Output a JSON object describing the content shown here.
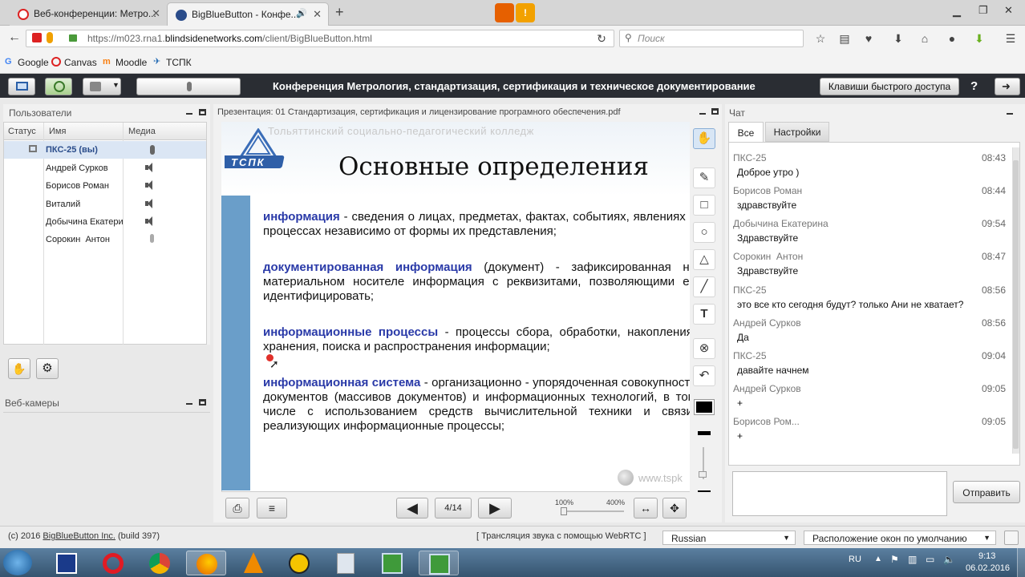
{
  "browser": {
    "tabs": [
      {
        "label": "Веб-конференции: Метро...",
        "active": false
      },
      {
        "label": "BigBlueButton - Конфе...",
        "active": true
      }
    ],
    "new_tab": "+",
    "url_host": "https://m023.rna1.",
    "url_domain": "blindsidenetworks.com",
    "url_path": "/client/BigBlueButton.html",
    "search_placeholder": "Поиск",
    "bookmarks": [
      "Google",
      "Canvas",
      "Moodle",
      "ТСПК"
    ]
  },
  "header": {
    "title": "Конференция Метрология, стандартизация, сертификация и техническое документирование",
    "shortcuts_button": "Клавиши быстрого доступа",
    "help": "?"
  },
  "users_panel": {
    "title": "Пользователи",
    "columns": [
      "Статус",
      "Имя",
      "Медиа"
    ],
    "users": [
      {
        "name": "ПКС-25 (вы)",
        "me": true
      },
      {
        "name": "Андрей Сурков"
      },
      {
        "name": "Борисов Роман"
      },
      {
        "name": "Виталий"
      },
      {
        "name": "Добычина Екатерин"
      },
      {
        "name": "Сорокин  Антон"
      }
    ]
  },
  "webcams_panel": {
    "title": "Веб-камеры"
  },
  "presentation": {
    "title": "Презентация: 01 Стандартизация, сертификация и лицензирование програмного обеспечения.pdf",
    "slide": {
      "college": "Тольяттинский социально-педагогический колледж",
      "logo": "ТСПК",
      "heading": "Основные определения",
      "defs": [
        {
          "term": "информация",
          "text": " - сведения о лицах, предметах, фактах, событиях, явлениях и процессах независимо от формы их представления;"
        },
        {
          "term": "документированная информация",
          "text": " (документ) - зафиксированная на материальном носителе информация с реквизитами, позволяющими ее идентифицировать;"
        },
        {
          "term": "информационные процессы",
          "text": " - процессы сбора, обработки, накопления, хранения, поиска и распространения информации;"
        },
        {
          "term": "информационная система",
          "text": " - организационно - упорядоченная совокупность документов (массивов документов) и информационных технологий, в том числе с использованием средств вычислительной техники и связи, реализующих информационные процессы;"
        }
      ],
      "website": "www.tspk"
    },
    "page": "4/14",
    "zoom_min": "100%",
    "zoom_max": "400%"
  },
  "chat": {
    "title": "Чат",
    "tabs": [
      "Все",
      "Настройки"
    ],
    "messages": [
      {
        "name": "ПКС-25",
        "time": "08:43",
        "text": "Доброе утро )"
      },
      {
        "name": "Борисов Роман",
        "time": "08:44",
        "text": "здравствуйте"
      },
      {
        "name": "Добычина Екатерина",
        "time": "09:54",
        "text": "Здравствуйте"
      },
      {
        "name": "Сорокин  Антон",
        "time": "08:47",
        "text": "Здравствуйте"
      },
      {
        "name": "ПКС-25",
        "time": "08:56",
        "text": "это все кто сегодня будут? только Ани не хватает?"
      },
      {
        "name": "Андрей Сурков",
        "time": "08:56",
        "text": "Да"
      },
      {
        "name": "ПКС-25",
        "time": "09:04",
        "text": "давайте начнем"
      },
      {
        "name": "Андрей Сурков",
        "time": "09:05",
        "text": "+"
      },
      {
        "name": "Борисов Ром...",
        "time": "09:05",
        "text": "+"
      }
    ],
    "send_button": "Отправить"
  },
  "footer": {
    "copyright": "(c) 2016",
    "link": "BigBlueButton Inc.",
    "build": "(build 397)",
    "audio": "[ Трансляция звука с помощью WebRTC ]",
    "language": "Russian",
    "layout": "Расположение окон по умолчанию"
  },
  "taskbar": {
    "lang": "RU",
    "time": "9:13",
    "date": "06.02.2016"
  }
}
